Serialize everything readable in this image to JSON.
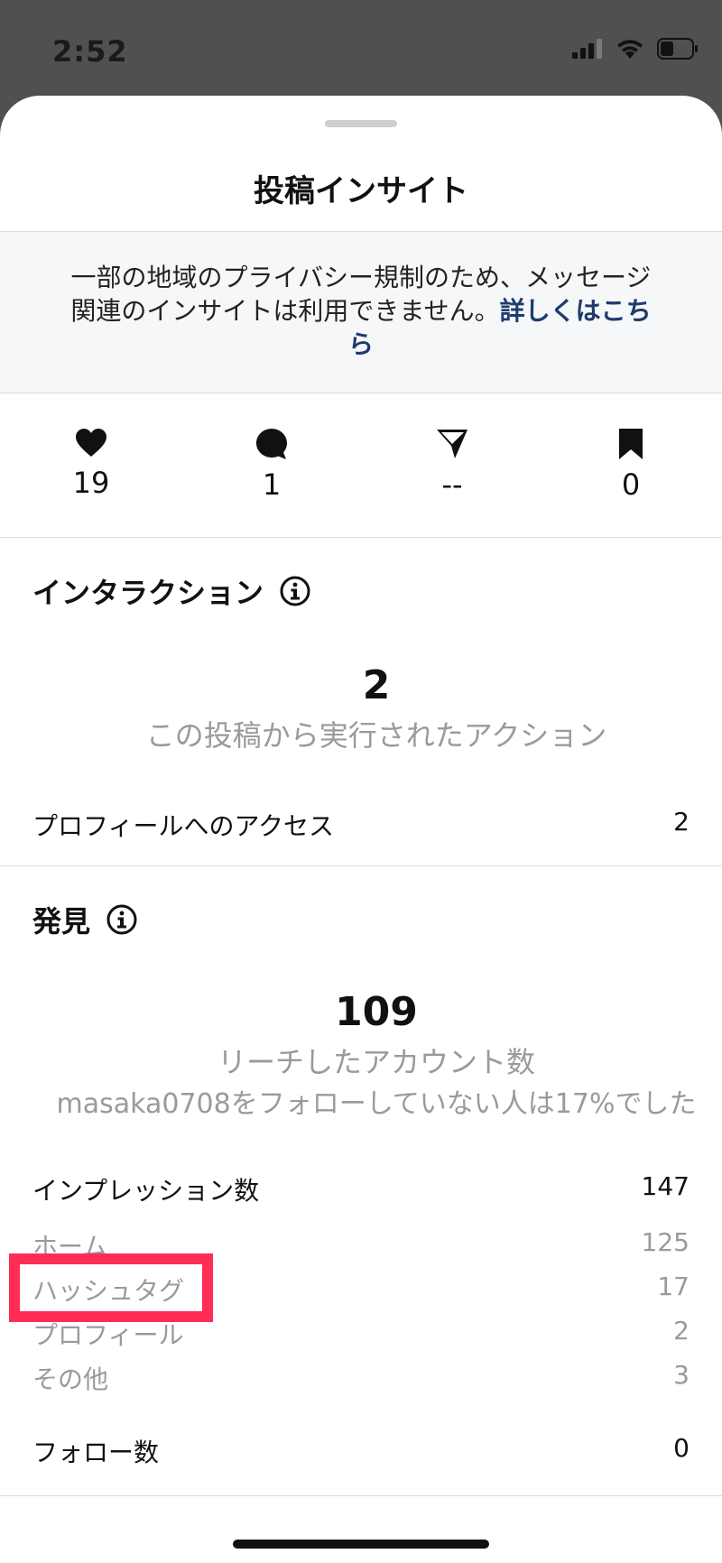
{
  "status_bar": {
    "time": "2:52",
    "icons": [
      "cellular-signal-icon",
      "wifi-icon",
      "battery-icon"
    ]
  },
  "sheet": {
    "title": "投稿インサイト",
    "notice": {
      "text": "一部の地域のプライバシー規制のため、メッセージ関連のインサイトは利用できません。",
      "link": "詳しくはこちら"
    }
  },
  "metrics": [
    {
      "icon": "heart-icon",
      "value": "19"
    },
    {
      "icon": "comment-icon",
      "value": "1"
    },
    {
      "icon": "share-icon",
      "value": "--"
    },
    {
      "icon": "bookmark-icon",
      "value": "0"
    }
  ],
  "interaction": {
    "title": "インタラクション",
    "total": "2",
    "subtitle": "この投稿から実行されたアクション",
    "rows": [
      {
        "label": "プロフィールへのアクセス",
        "value": "2"
      }
    ]
  },
  "discovery": {
    "title": "発見",
    "reach": "109",
    "reach_label": "リーチしたアカウント数",
    "reach_note": "masaka0708をフォローしていない人は17%でした",
    "impressions": {
      "label": "インプレッション数",
      "value": "147"
    },
    "breakdown": [
      {
        "label": "ホーム",
        "value": "125"
      },
      {
        "label": "ハッシュタグ",
        "value": "17"
      },
      {
        "label": "プロフィール",
        "value": "2"
      },
      {
        "label": "その他",
        "value": "3"
      }
    ],
    "follows": {
      "label": "フォロー数",
      "value": "0"
    }
  },
  "colors": {
    "highlight": "#ff2d55",
    "link": "#1d3b6e",
    "muted_text": "#9a9a9a"
  }
}
